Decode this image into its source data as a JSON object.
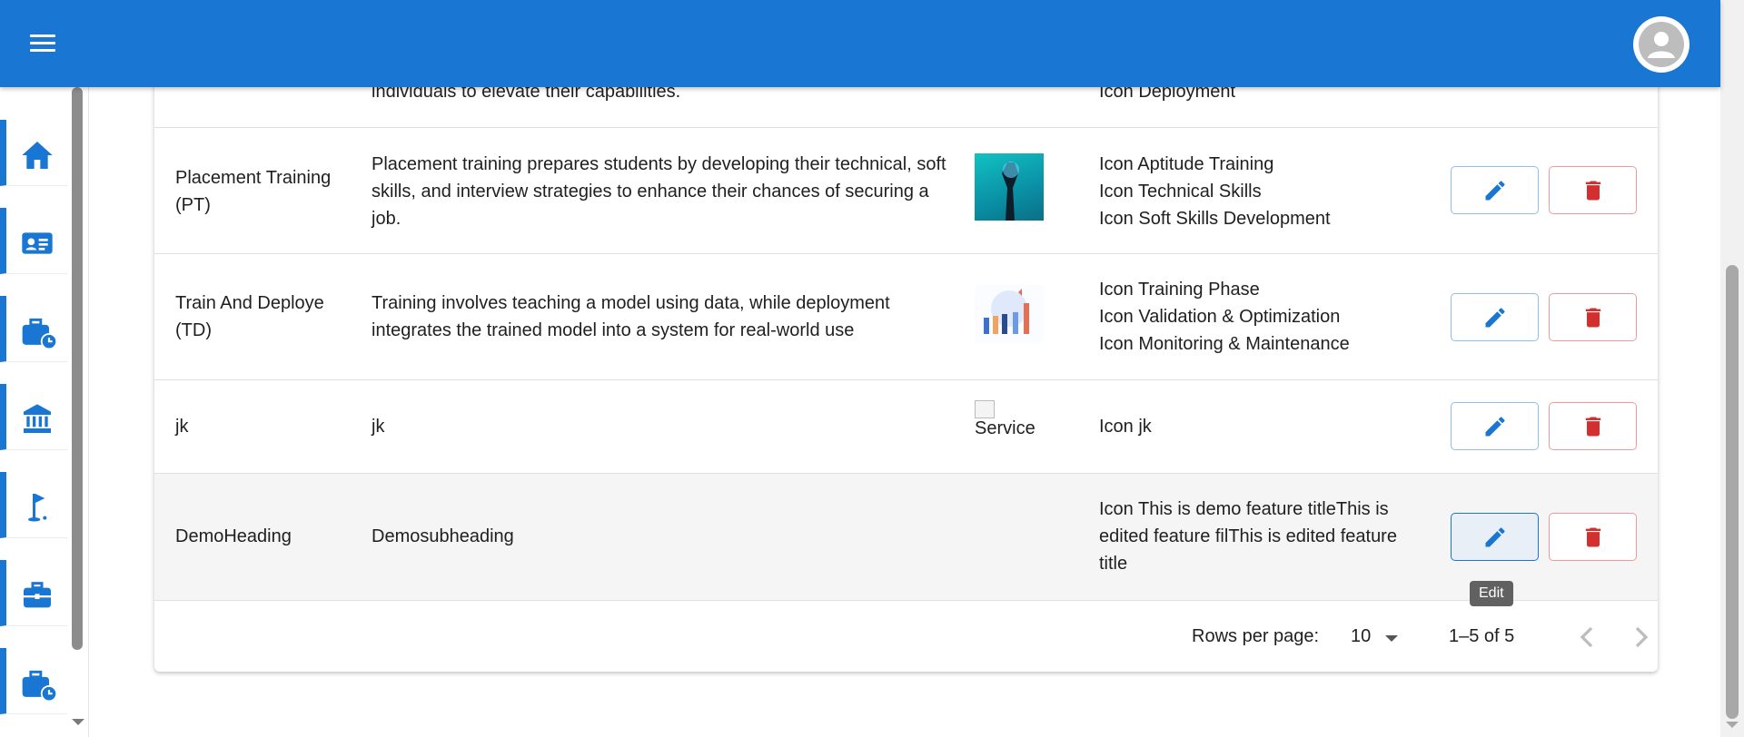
{
  "appbar": {
    "color": "#1976d2",
    "menu_icon": "hamburger-menu-icon",
    "avatar_icon": "account-circle-icon"
  },
  "sidebar": {
    "items": [
      {
        "icon": "home-icon"
      },
      {
        "icon": "contact-card-icon"
      },
      {
        "icon": "briefcase-clock-icon"
      },
      {
        "icon": "bank-icon"
      },
      {
        "icon": "golf-flag-icon"
      },
      {
        "icon": "briefcase-icon"
      },
      {
        "icon": "briefcase-clock-icon"
      }
    ]
  },
  "table": {
    "rows": [
      {
        "title": "",
        "description": "individuals to elevate their capabilities.",
        "image_alt": "",
        "features": [
          "Icon Deployment"
        ]
      },
      {
        "title": "Placement Training (PT)",
        "description": "Placement training prepares students by developing their technical, soft skills, and interview strategies to enhance their chances of securing a job.",
        "image_alt": "",
        "features": [
          "Icon Aptitude Training",
          "Icon Technical Skills",
          "Icon Soft Skills Development"
        ]
      },
      {
        "title": "Train And Deploye (TD)",
        "description": "Training involves teaching a model using data, while deployment integrates the trained model into a system for real-world use",
        "image_alt": "",
        "features": [
          "Icon Training Phase",
          "Icon Validation & Optimization",
          "Icon Monitoring & Maintenance"
        ]
      },
      {
        "title": "jk",
        "description": "jk",
        "image_alt": "Service",
        "features": [
          "Icon jk"
        ]
      },
      {
        "title": "DemoHeading",
        "description": "Demosubheading",
        "image_alt": "",
        "features_text": "Icon This is demo feature titleThis is edited feature filThis is edited feature title"
      }
    ],
    "edit_icon": "pencil-icon",
    "delete_icon": "trash-icon",
    "edit_color": "#1976d2",
    "delete_color": "#d32f2f"
  },
  "pagination": {
    "rows_per_page_label": "Rows per page:",
    "rows_per_page_value": "10",
    "range": "1–5 of 5",
    "prev_icon": "chevron-left-icon",
    "next_icon": "chevron-right-icon"
  },
  "tooltip": {
    "text": "Edit"
  }
}
